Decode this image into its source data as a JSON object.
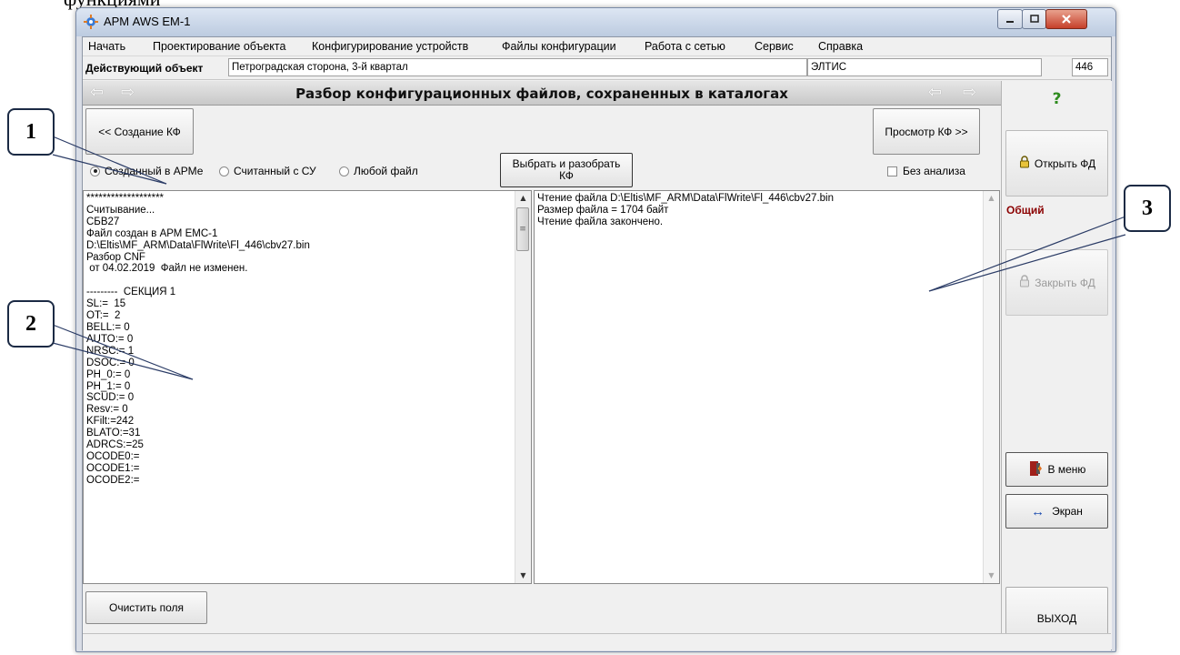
{
  "top_caption": "функциями",
  "window": {
    "title": "АРМ AWS EM-1"
  },
  "menu": [
    "Начать",
    "Проектирование объекта",
    "Конфигурирование устройств",
    "Файлы конфигурации",
    "Работа с сетью",
    "Сервис",
    "Справка"
  ],
  "object_bar": {
    "label": "Действующий объект",
    "name": "Петроградская сторона, 3-й квартал",
    "system": "ЭЛТИС",
    "number": "446"
  },
  "header": {
    "title": "Разбор конфигурационных файлов, сохраненных в каталогах"
  },
  "nav_buttons": {
    "prev": "<< Создание КФ",
    "next": "Просмотр КФ >>"
  },
  "source_options": {
    "items": [
      {
        "label": "Созданный в АРМе",
        "selected": true
      },
      {
        "label": "Считанный с СУ",
        "selected": false
      },
      {
        "label": "Любой файл",
        "selected": false
      }
    ]
  },
  "parse_button": {
    "line1": "Выбрать и разобрать",
    "line2": "КФ"
  },
  "no_analysis": {
    "label": "Без анализа",
    "checked": false
  },
  "left_pane": {
    "lines": [
      "*******************",
      "Считывание...",
      "СБВ27",
      "Файл создан в АРМ ЕМС-1",
      "D:\\Eltis\\MF_ARM\\Data\\FlWrite\\Fl_446\\cbv27.bin",
      "Разбор CNF",
      " от 04.02.2019  Файл не изменен.",
      "",
      "---------  СЕКЦИЯ 1",
      "SL:=  15",
      "OT:=  2",
      "BELL:= 0",
      "AUTO:= 0",
      "NRSC:= 1",
      "DSOC:= 0",
      "PH_0:= 0",
      "PH_1:= 0",
      "SCUD:= 0",
      "Resv:= 0",
      "KFilt:=242",
      "BLATO:=31",
      "ADRCS:=25",
      "OCODE0:=",
      "OCODE1:=",
      "OCODE2:="
    ]
  },
  "right_pane": {
    "lines": [
      "Чтение файла D:\\Eltis\\MF_ARM\\Data\\FlWrite\\Fl_446\\cbv27.bin",
      "Размер файла = 1704 байт",
      "Чтение файла закончено."
    ]
  },
  "side_panel": {
    "help_glyph": "?",
    "open_fd": "Открыть ФД",
    "general_label": "Общий",
    "close_fd": "Закрыть ФД",
    "to_menu": "В меню",
    "screen": "Экран",
    "exit": "ВЫХОД"
  },
  "clear_button": "Очистить поля",
  "callouts": [
    "1",
    "2",
    "3"
  ],
  "colors": {
    "general_label": "#8b0000",
    "help_glyph": "#2e8b1e",
    "screen_arrow": "#1f4fb0"
  }
}
